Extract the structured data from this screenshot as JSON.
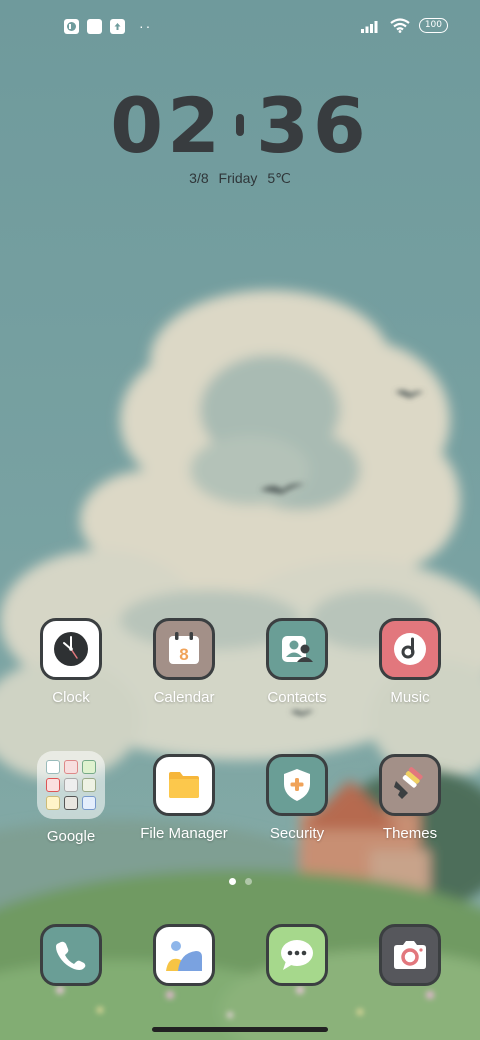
{
  "status_bar": {
    "left_icons": [
      "app-notification-icon",
      "square-notification-icon",
      "upload-icon"
    ],
    "more_indicator": "··",
    "battery_level": "100"
  },
  "clock_widget": {
    "hours": "02",
    "minutes": "36",
    "date": "3/8",
    "weekday": "Friday",
    "temperature": "5℃"
  },
  "apps_row1": [
    {
      "label": "Clock",
      "icon": "clock-icon",
      "bg": "#ffffff"
    },
    {
      "label": "Calendar",
      "icon": "calendar-icon",
      "bg": "#a39088"
    },
    {
      "label": "Contacts",
      "icon": "contacts-icon",
      "bg": "#6a9e96"
    },
    {
      "label": "Music",
      "icon": "music-icon",
      "bg": "#e2777d"
    }
  ],
  "apps_row2": [
    {
      "label": "Google",
      "icon": "google-folder-icon"
    },
    {
      "label": "File Manager",
      "icon": "folder-icon",
      "bg": "#ffffff"
    },
    {
      "label": "Security",
      "icon": "security-shield-icon",
      "bg": "#6a9e96"
    },
    {
      "label": "Themes",
      "icon": "paintbrush-icon",
      "bg": "#a39088"
    }
  ],
  "dock": [
    {
      "name": "phone",
      "icon": "phone-icon",
      "bg": "#6a9e96"
    },
    {
      "name": "gallery",
      "icon": "gallery-icon",
      "bg": "#ffffff"
    },
    {
      "name": "messages",
      "icon": "message-icon",
      "bg": "#a6d88c"
    },
    {
      "name": "camera",
      "icon": "camera-icon",
      "bg": "#56575c"
    }
  ],
  "calendar_day": "8",
  "page_indicator": {
    "total": 2,
    "active": 1
  },
  "colors": {
    "sky": "#6f9c9d",
    "icon_outline": "#3b3f41",
    "accent_orange": "#f0a35a"
  }
}
